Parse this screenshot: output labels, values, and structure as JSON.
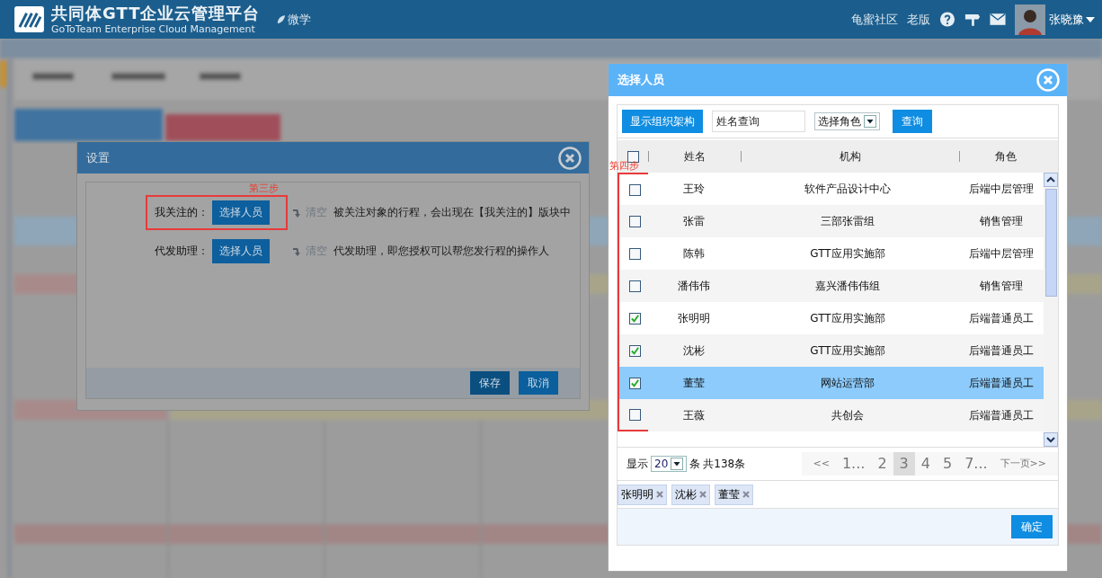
{
  "header": {
    "title": "共同体GTT企业云管理平台",
    "subtitle": "GoToTeam Enterprise Cloud Management",
    "learn_link": "微学",
    "nav_links": [
      "龟蜜社区",
      "老版"
    ],
    "user_name": "张晓豫"
  },
  "settings_dialog": {
    "title": "设置",
    "annotation": "第三步",
    "rows": [
      {
        "label": "我关注的：",
        "button": "选择人员",
        "clear": "清空",
        "description": "被关注对象的行程，会出现在【我关注的】版块中",
        "highlighted": true
      },
      {
        "label": "代发助理：",
        "button": "选择人员",
        "clear": "清空",
        "description": "代发助理，即您授权可以帮您发行程的操作人",
        "highlighted": false
      }
    ],
    "buttons": [
      {
        "label": "保存",
        "kind": "primary"
      },
      {
        "label": "取消",
        "kind": "secondary"
      }
    ]
  },
  "select_dialog": {
    "title": "选择人员",
    "org_button": "显示组织架构",
    "search_value": "姓名查询",
    "role_select": "选择角色",
    "query_button": "查询",
    "annotation": "第四步",
    "select_all_checked": false,
    "columns": [
      "姓名",
      "机构",
      "角色"
    ],
    "rows": [
      {
        "name": "王玲",
        "org": "软件产品设计中心",
        "role": "后端中层管理",
        "checked": false,
        "selected": false
      },
      {
        "name": "张雷",
        "org": "三部张雷组",
        "role": "销售管理",
        "checked": false,
        "selected": false
      },
      {
        "name": "陈韩",
        "org": "GTT应用实施部",
        "role": "后端中层管理",
        "checked": false,
        "selected": false
      },
      {
        "name": "潘伟伟",
        "org": "嘉兴潘伟伟组",
        "role": "销售管理",
        "checked": false,
        "selected": false
      },
      {
        "name": "张明明",
        "org": "GTT应用实施部",
        "role": "后端普通员工",
        "checked": true,
        "selected": false
      },
      {
        "name": "沈彬",
        "org": "GTT应用实施部",
        "role": "后端普通员工",
        "checked": true,
        "selected": false
      },
      {
        "name": "董莹",
        "org": "网站运营部",
        "role": "后端普通员工",
        "checked": true,
        "selected": true
      },
      {
        "name": "王薇",
        "org": "共创会",
        "role": "后端普通员工",
        "checked": false,
        "selected": false
      }
    ],
    "pager": {
      "show_label": "显示",
      "page_size": "20",
      "unit": "条",
      "total": "共138条",
      "pages": [
        {
          "label": "<<",
          "selected": false
        },
        {
          "label": "1...",
          "selected": false
        },
        {
          "label": "2",
          "selected": false
        },
        {
          "label": "3",
          "selected": true
        },
        {
          "label": "4",
          "selected": false
        },
        {
          "label": "5",
          "selected": false
        },
        {
          "label": "7...",
          "selected": false
        },
        {
          "label": "下一页>>",
          "selected": false
        }
      ]
    },
    "chosen": [
      "张明明",
      "沈彬",
      "董莹"
    ],
    "confirm_button": "确定"
  }
}
